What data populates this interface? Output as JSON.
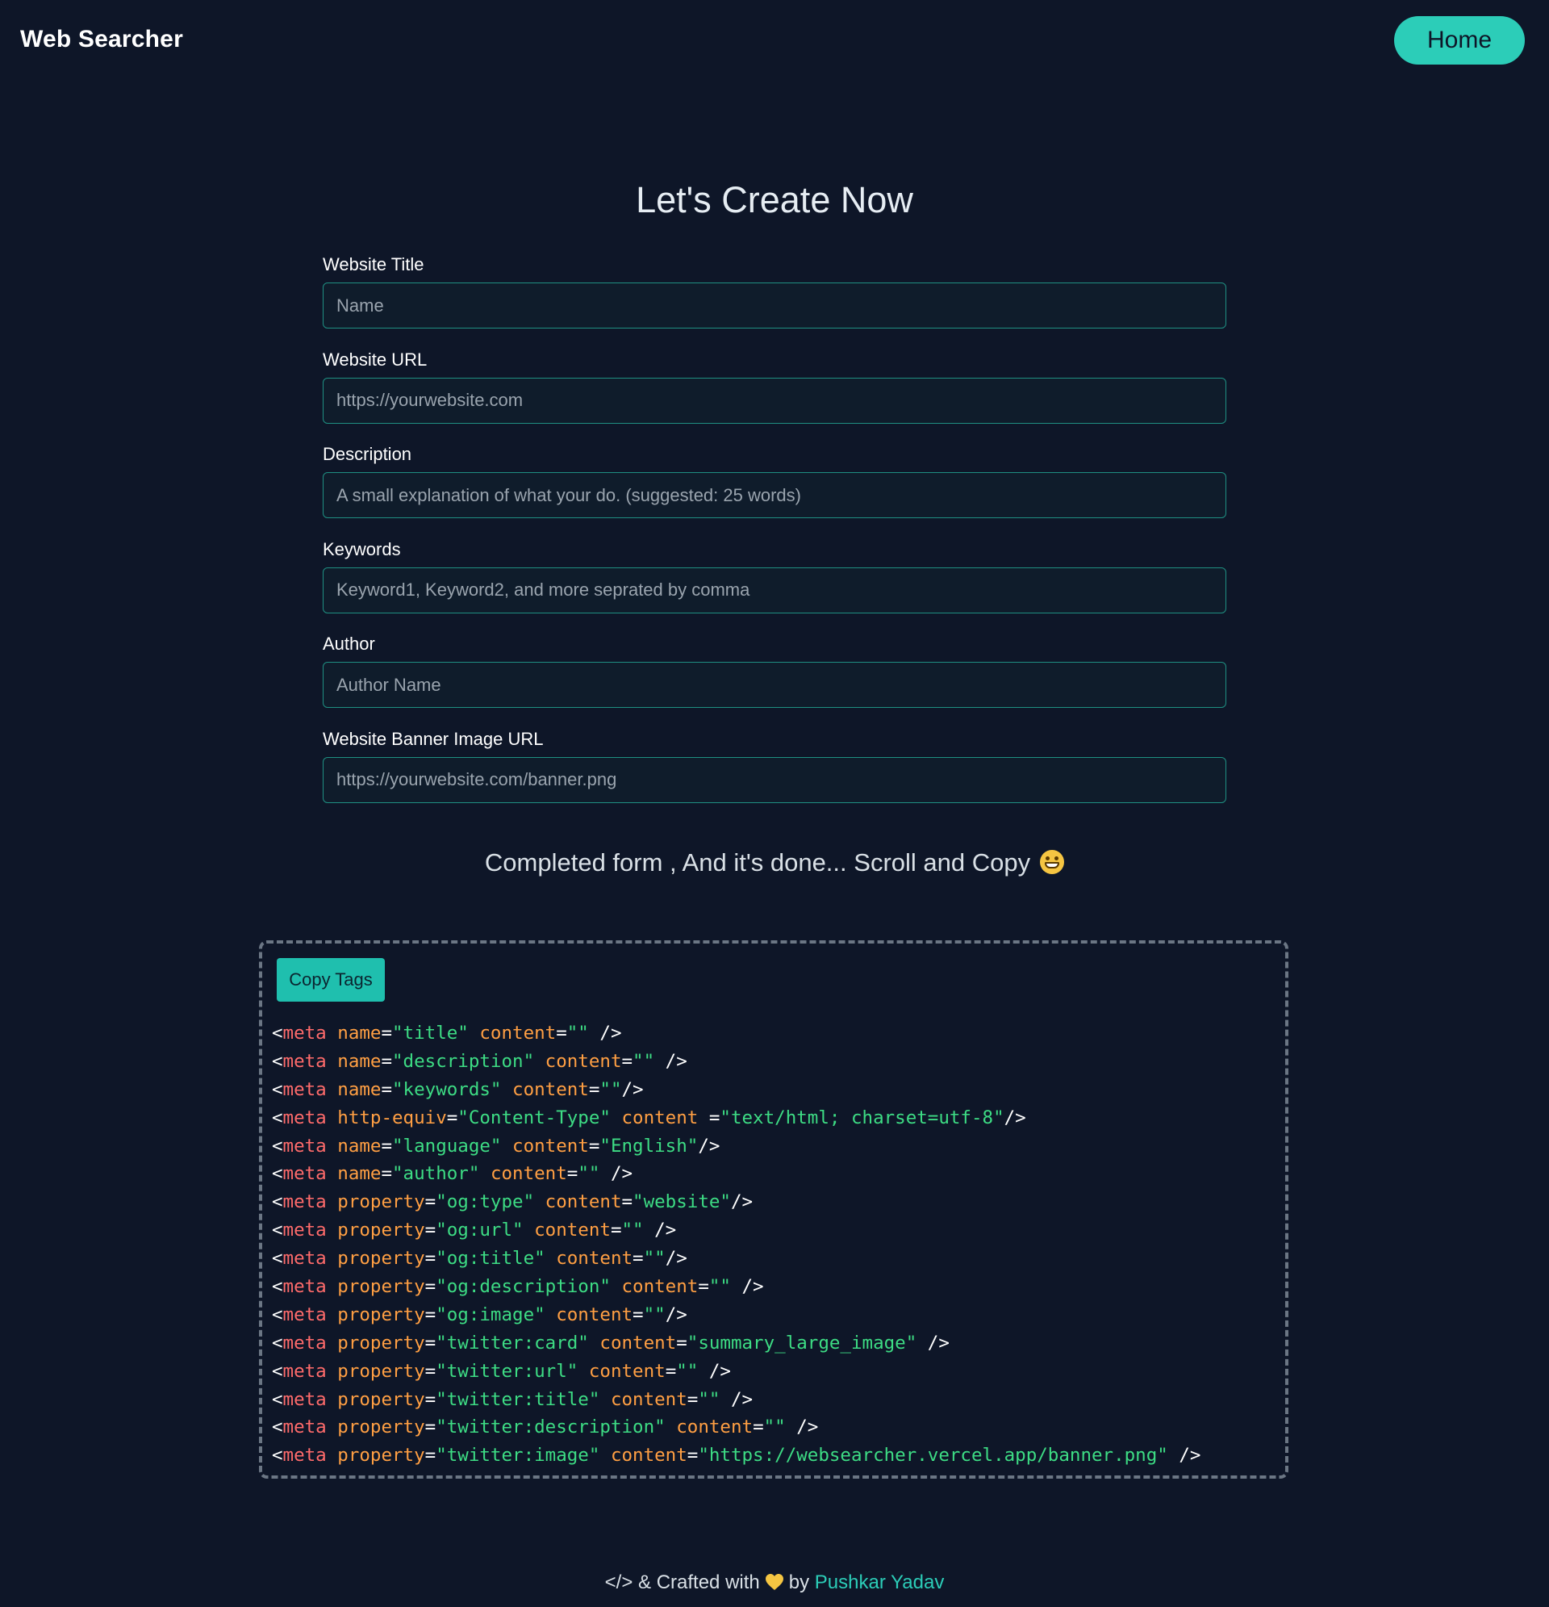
{
  "nav": {
    "brand": "Web Searcher",
    "home_label": "Home"
  },
  "page_title": "Let's Create Now",
  "form": {
    "fields": [
      {
        "label": "Website Title",
        "placeholder": "Name",
        "value": ""
      },
      {
        "label": "Website URL",
        "placeholder": "https://yourwebsite.com",
        "value": ""
      },
      {
        "label": "Description",
        "placeholder": "A small explanation of what your do. (suggested: 25 words)",
        "value": ""
      },
      {
        "label": "Keywords",
        "placeholder": "Keyword1, Keyword2, and more seprated by comma",
        "value": ""
      },
      {
        "label": "Author",
        "placeholder": "Author Name",
        "value": ""
      },
      {
        "label": "Website Banner Image URL",
        "placeholder": "https://yourwebsite.com/banner.png",
        "value": ""
      }
    ]
  },
  "completed_message": "Completed form , And it's done... Scroll and Copy",
  "completed_emoji": "grinning-face-emoji",
  "code_box": {
    "copy_label": "Copy Tags",
    "lines": [
      [
        [
          "punc",
          "<"
        ],
        [
          "tag",
          "meta"
        ],
        [
          "sp",
          " "
        ],
        [
          "attr",
          "name"
        ],
        [
          "punc",
          "="
        ],
        [
          "str",
          "\"title\""
        ],
        [
          "sp",
          " "
        ],
        [
          "attr",
          "content"
        ],
        [
          "punc",
          "="
        ],
        [
          "str",
          "\"\""
        ],
        [
          "punc",
          " />"
        ]
      ],
      [
        [
          "punc",
          "<"
        ],
        [
          "tag",
          "meta"
        ],
        [
          "sp",
          " "
        ],
        [
          "attr",
          "name"
        ],
        [
          "punc",
          "="
        ],
        [
          "str",
          "\"description\""
        ],
        [
          "sp",
          " "
        ],
        [
          "attr",
          "content"
        ],
        [
          "punc",
          "="
        ],
        [
          "str",
          "\"\""
        ],
        [
          "punc",
          " />"
        ]
      ],
      [
        [
          "punc",
          "<"
        ],
        [
          "tag",
          "meta"
        ],
        [
          "sp",
          " "
        ],
        [
          "attr",
          "name"
        ],
        [
          "punc",
          "="
        ],
        [
          "str",
          "\"keywords\""
        ],
        [
          "sp",
          " "
        ],
        [
          "attr",
          "content"
        ],
        [
          "punc",
          "="
        ],
        [
          "str",
          "\"\""
        ],
        [
          "punc",
          "/>"
        ]
      ],
      [
        [
          "punc",
          "<"
        ],
        [
          "tag",
          "meta"
        ],
        [
          "sp",
          " "
        ],
        [
          "attr",
          "http-equiv"
        ],
        [
          "punc",
          "="
        ],
        [
          "str",
          "\"Content-Type\""
        ],
        [
          "sp",
          " "
        ],
        [
          "attr",
          "content"
        ],
        [
          "sp",
          " "
        ],
        [
          "punc",
          "="
        ],
        [
          "str",
          "\"text/html; charset=utf-8\""
        ],
        [
          "punc",
          "/>"
        ]
      ],
      [
        [
          "punc",
          "<"
        ],
        [
          "tag",
          "meta"
        ],
        [
          "sp",
          " "
        ],
        [
          "attr",
          "name"
        ],
        [
          "punc",
          "="
        ],
        [
          "str",
          "\"language\""
        ],
        [
          "sp",
          " "
        ],
        [
          "attr",
          "content"
        ],
        [
          "punc",
          "="
        ],
        [
          "str",
          "\"English\""
        ],
        [
          "punc",
          "/>"
        ]
      ],
      [
        [
          "punc",
          "<"
        ],
        [
          "tag",
          "meta"
        ],
        [
          "sp",
          " "
        ],
        [
          "attr",
          "name"
        ],
        [
          "punc",
          "="
        ],
        [
          "str",
          "\"author\""
        ],
        [
          "sp",
          " "
        ],
        [
          "attr",
          "content"
        ],
        [
          "punc",
          "="
        ],
        [
          "str",
          "\"\""
        ],
        [
          "punc",
          " />"
        ]
      ],
      [
        [
          "punc",
          "<"
        ],
        [
          "tag",
          "meta"
        ],
        [
          "sp",
          " "
        ],
        [
          "attr",
          "property"
        ],
        [
          "punc",
          "="
        ],
        [
          "str",
          "\"og:type\""
        ],
        [
          "sp",
          " "
        ],
        [
          "attr",
          "content"
        ],
        [
          "punc",
          "="
        ],
        [
          "str",
          "\"website\""
        ],
        [
          "punc",
          "/>"
        ]
      ],
      [
        [
          "punc",
          "<"
        ],
        [
          "tag",
          "meta"
        ],
        [
          "sp",
          " "
        ],
        [
          "attr",
          "property"
        ],
        [
          "punc",
          "="
        ],
        [
          "str",
          "\"og:url\""
        ],
        [
          "sp",
          " "
        ],
        [
          "attr",
          "content"
        ],
        [
          "punc",
          "="
        ],
        [
          "str",
          "\"\""
        ],
        [
          "punc",
          " />"
        ]
      ],
      [
        [
          "punc",
          "<"
        ],
        [
          "tag",
          "meta"
        ],
        [
          "sp",
          " "
        ],
        [
          "attr",
          "property"
        ],
        [
          "punc",
          "="
        ],
        [
          "str",
          "\"og:title\""
        ],
        [
          "sp",
          " "
        ],
        [
          "attr",
          "content"
        ],
        [
          "punc",
          "="
        ],
        [
          "str",
          "\"\""
        ],
        [
          "punc",
          "/>"
        ]
      ],
      [
        [
          "punc",
          "<"
        ],
        [
          "tag",
          "meta"
        ],
        [
          "sp",
          " "
        ],
        [
          "attr",
          "property"
        ],
        [
          "punc",
          "="
        ],
        [
          "str",
          "\"og:description\""
        ],
        [
          "sp",
          " "
        ],
        [
          "attr",
          "content"
        ],
        [
          "punc",
          "="
        ],
        [
          "str",
          "\"\""
        ],
        [
          "punc",
          " />"
        ]
      ],
      [
        [
          "punc",
          "<"
        ],
        [
          "tag",
          "meta"
        ],
        [
          "sp",
          " "
        ],
        [
          "attr",
          "property"
        ],
        [
          "punc",
          "="
        ],
        [
          "str",
          "\"og:image\""
        ],
        [
          "sp",
          " "
        ],
        [
          "attr",
          "content"
        ],
        [
          "punc",
          "="
        ],
        [
          "str",
          "\"\""
        ],
        [
          "punc",
          "/>"
        ]
      ],
      [
        [
          "punc",
          "<"
        ],
        [
          "tag",
          "meta"
        ],
        [
          "sp",
          " "
        ],
        [
          "attr",
          "property"
        ],
        [
          "punc",
          "="
        ],
        [
          "str",
          "\"twitter:card\""
        ],
        [
          "sp",
          " "
        ],
        [
          "attr",
          "content"
        ],
        [
          "punc",
          "="
        ],
        [
          "str",
          "\"summary_large_image\""
        ],
        [
          "punc",
          " />"
        ]
      ],
      [
        [
          "punc",
          "<"
        ],
        [
          "tag",
          "meta"
        ],
        [
          "sp",
          " "
        ],
        [
          "attr",
          "property"
        ],
        [
          "punc",
          "="
        ],
        [
          "str",
          "\"twitter:url\""
        ],
        [
          "sp",
          " "
        ],
        [
          "attr",
          "content"
        ],
        [
          "punc",
          "="
        ],
        [
          "str",
          "\"\""
        ],
        [
          "punc",
          " />"
        ]
      ],
      [
        [
          "punc",
          "<"
        ],
        [
          "tag",
          "meta"
        ],
        [
          "sp",
          " "
        ],
        [
          "attr",
          "property"
        ],
        [
          "punc",
          "="
        ],
        [
          "str",
          "\"twitter:title\""
        ],
        [
          "sp",
          " "
        ],
        [
          "attr",
          "content"
        ],
        [
          "punc",
          "="
        ],
        [
          "str",
          "\"\""
        ],
        [
          "punc",
          " />"
        ]
      ],
      [
        [
          "punc",
          "<"
        ],
        [
          "tag",
          "meta"
        ],
        [
          "sp",
          " "
        ],
        [
          "attr",
          "property"
        ],
        [
          "punc",
          "="
        ],
        [
          "str",
          "\"twitter:description\""
        ],
        [
          "sp",
          " "
        ],
        [
          "attr",
          "content"
        ],
        [
          "punc",
          "="
        ],
        [
          "str",
          "\"\""
        ],
        [
          "punc",
          " />"
        ]
      ],
      [
        [
          "punc",
          "<"
        ],
        [
          "tag",
          "meta"
        ],
        [
          "sp",
          " "
        ],
        [
          "attr",
          "property"
        ],
        [
          "punc",
          "="
        ],
        [
          "str",
          "\"twitter:image\""
        ],
        [
          "sp",
          " "
        ],
        [
          "attr",
          "content"
        ],
        [
          "punc",
          "="
        ],
        [
          "str",
          "\"https://websearcher.vercel.app/banner.png\""
        ],
        [
          "punc",
          " />"
        ]
      ]
    ]
  },
  "footer": {
    "prefix": "</> & Crafted with",
    "heart_icon": "yellow-heart-icon",
    "by": "by",
    "author": "Pushkar Yadav"
  },
  "colors": {
    "background": "#0e1628",
    "accent": "#2ccdb8",
    "copy_button": "#1fbfae",
    "input_border": "#1f8f82",
    "code_tag": "#ff6b6b",
    "code_attr": "#ff9f43",
    "code_string": "#3ddc84",
    "heart": "#f5c542"
  }
}
